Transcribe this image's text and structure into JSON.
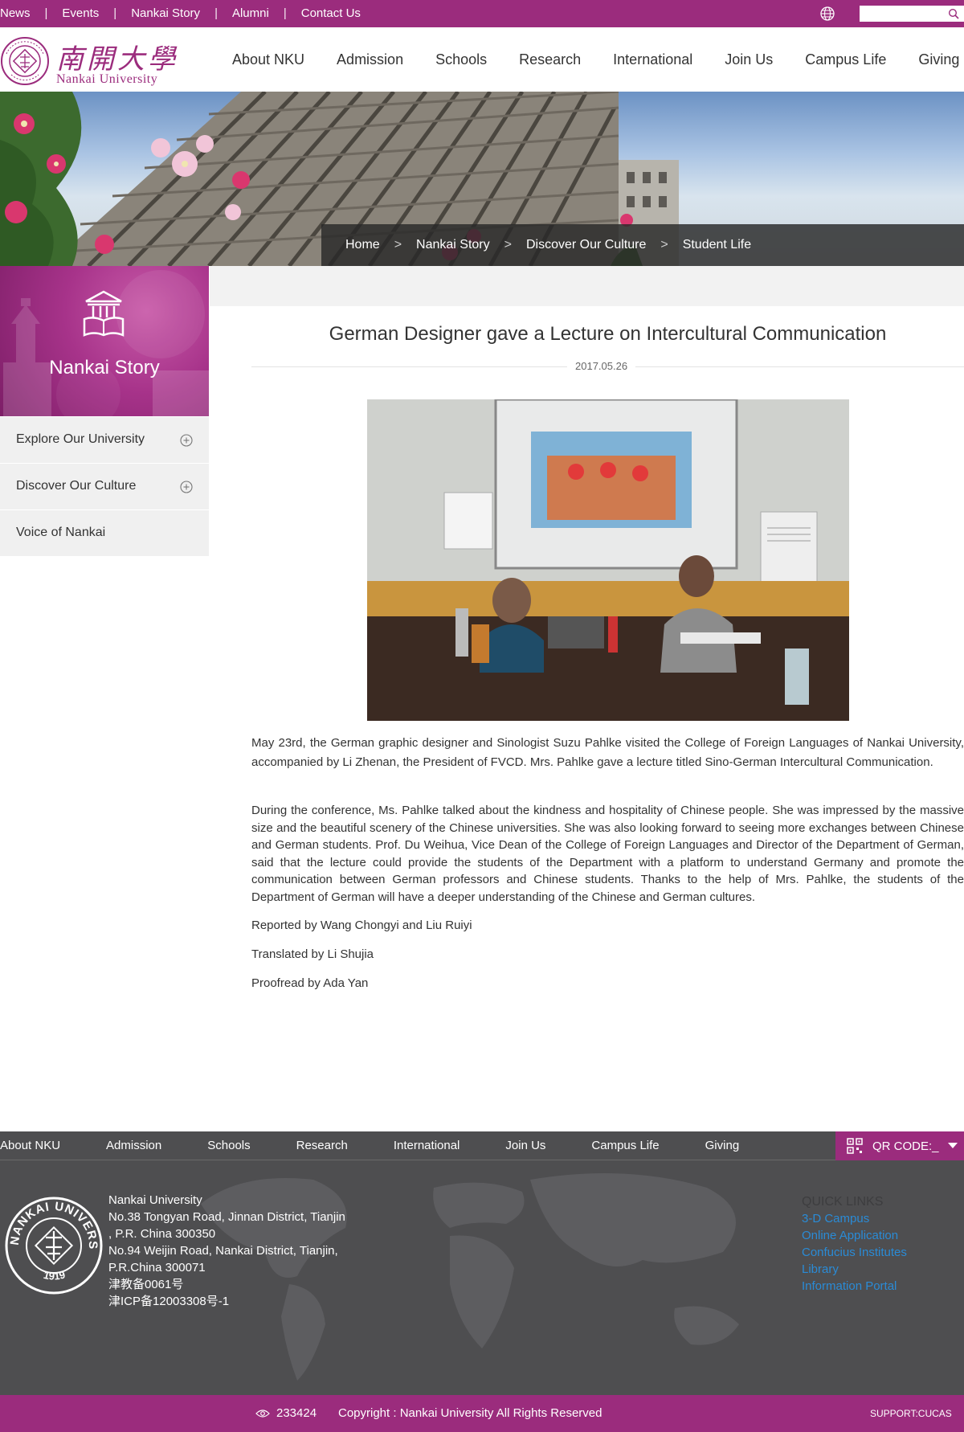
{
  "topbar": {
    "links": [
      "News",
      "Events",
      "Nankai Story",
      "Alumni",
      "Contact Us"
    ],
    "separator": "|",
    "search_placeholder": ""
  },
  "header": {
    "logo_chinese": "南開大學",
    "logo_english": "Nankai University",
    "nav": [
      "About NKU",
      "Admission",
      "Schools",
      "Research",
      "International",
      "Join Us",
      "Campus Life",
      "Giving"
    ]
  },
  "breadcrumb": {
    "items": [
      "Home",
      "Nankai Story",
      "Discover Our Culture",
      "Student Life"
    ],
    "separator": ">"
  },
  "sidebar": {
    "title": "Nankai Story",
    "items": [
      {
        "label": "Explore Our University",
        "expandable": true
      },
      {
        "label": "Discover Our Culture",
        "expandable": true
      },
      {
        "label": "Voice of Nankai",
        "expandable": false
      }
    ]
  },
  "article": {
    "title": "German Designer gave a Lecture on Intercultural Communication",
    "date": "2017.05.26",
    "paragraphs": [
      "May 23rd, the German graphic designer and Sinologist Suzu Pahlke visited the College of Foreign Languages of Nankai University, accompanied by Li Zhenan, the President of FVCD. Mrs. Pahlke gave a lecture titled Sino-German Intercultural Communication.",
      "During the conference, Ms. Pahlke talked about the kindness and hospitality of Chinese people. She was impressed by the massive size and the beautiful scenery of the Chinese universities. She was also looking forward to seeing more exchanges between Chinese and  German students. Prof. Du Weihua, Vice Dean of the College of Foreign Languages and Director of the Department of German, said that the lecture could provide the students of the Department with a platform to understand Germany and promote the communication between German professors and Chinese students. Thanks to the help of Mrs. Pahlke, the students of the Department of German will have a deeper understanding of the Chinese and German cultures.",
      "Reported by Wang Chongyi and Liu Ruiyi",
      "Translated by Li Shujia",
      "Proofread by Ada Yan"
    ]
  },
  "footer": {
    "nav": [
      "About NKU",
      "Admission",
      "Schools",
      "Research",
      "International",
      "Join Us",
      "Campus Life",
      "Giving"
    ],
    "qr_label": "QR CODE:_",
    "address_lines": [
      "Nankai University",
      "No.38 Tongyan Road, Jinnan District, Tianjin",
      ", P.R. China 300350",
      "No.94 Weijin Road,  Nankai District, Tianjin,",
      "P.R.China  300071",
      "津教备0061号",
      "津ICP备12003308号-1"
    ],
    "quick_links_title": "QUICK LINKS",
    "quick_links": [
      "3-D Campus",
      "Online Application",
      "Confucius Institutes",
      "Library",
      "Information Portal"
    ],
    "seal_text": "NANKAI UNIVERSITY",
    "seal_year": "1919"
  },
  "bottombar": {
    "visits": "233424",
    "copyright": "Copyright : Nankai University All Rights Reserved",
    "support": "SUPPORT:CUCAS"
  },
  "colors": {
    "brand": "#9b2c7d",
    "footer_bg": "#4e4e50",
    "link_blue": "#2a8bd6",
    "sidebar_item_bg": "#f0f0f0"
  },
  "icons": [
    "globe-icon",
    "search-icon",
    "library-icon",
    "plus-circle-icon",
    "qr-code-icon",
    "caret-down-icon",
    "eye-icon",
    "seal-logo"
  ]
}
